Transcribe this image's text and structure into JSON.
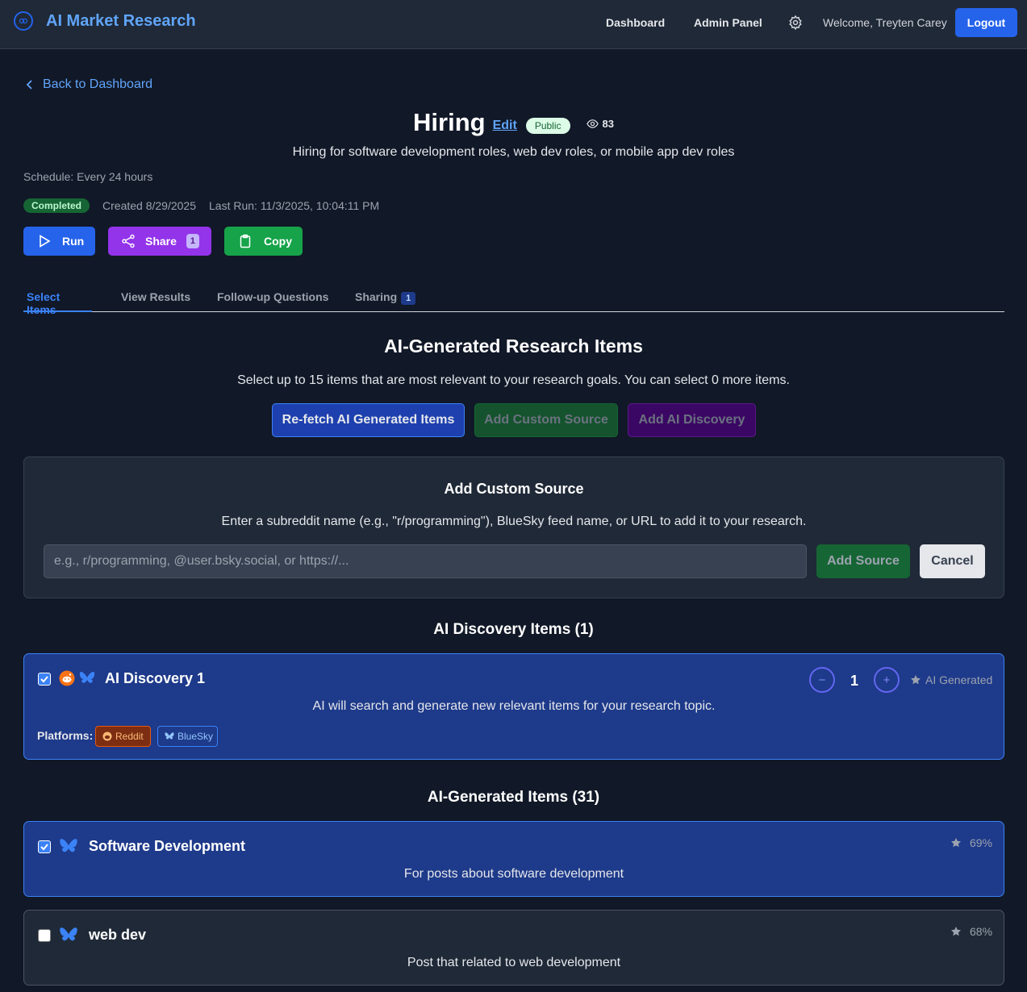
{
  "nav": {
    "brand": "AI Market Research",
    "links": [
      "Dashboard",
      "Admin Panel"
    ],
    "welcome": "Welcome, Treyten Carey",
    "logout": "Logout"
  },
  "back_link": "Back to Dashboard",
  "research": {
    "title": "Hiring",
    "edit": "Edit",
    "visibility": "Public",
    "views": "83",
    "description": "Hiring for software development roles, web dev roles, or mobile app dev roles",
    "schedule": "Schedule: Every 24 hours",
    "status": "Completed",
    "created": "Created 8/29/2025",
    "last_run": "Last Run: 11/3/2025, 10:04:11 PM"
  },
  "actions": {
    "run": "Run",
    "share": "Share",
    "share_count": "1",
    "copy": "Copy"
  },
  "tabs": [
    {
      "label": "Select Items",
      "active": true
    },
    {
      "label": "View Results"
    },
    {
      "label": "Follow-up Questions"
    },
    {
      "label": "Sharing",
      "count": "1"
    }
  ],
  "section": {
    "title": "AI-Generated Research Items",
    "subtitle": "Select up to 15 items that are most relevant to your research goals. You can select 0 more items.",
    "refetch": "Re-fetch AI Generated Items",
    "add_custom": "Add Custom Source",
    "add_ai": "Add AI Discovery"
  },
  "custom_source": {
    "title": "Add Custom Source",
    "description": "Enter a subreddit name (e.g., \"r/programming\"), BlueSky feed name, or URL to add it to your research.",
    "placeholder": "e.g., r/programming, @user.bsky.social, or https://...",
    "add": "Add Source",
    "cancel": "Cancel"
  },
  "discovery": {
    "heading": "AI Discovery Items (1)",
    "item": {
      "title": "AI Discovery 1",
      "checked": true,
      "description": "AI will search and generate new relevant items for your research topic.",
      "count": "1",
      "minus": "−",
      "plus": "+",
      "tag": "AI Generated",
      "platforms_label": "Platforms:",
      "platforms": [
        "Reddit",
        "BlueSky"
      ]
    }
  },
  "generated": {
    "heading": "AI-Generated Items (31)",
    "items": [
      {
        "title": "Software Development",
        "description": "For posts about software development",
        "score": "69%",
        "checked": true
      },
      {
        "title": "web dev",
        "description": "Post that related to web development",
        "score": "68%",
        "checked": false
      }
    ]
  },
  "colors": {
    "background": "#111827",
    "primary": "#2563eb",
    "share": "#9333ea",
    "copy": "#16a34a",
    "selected_card": "#1e3a8a"
  }
}
